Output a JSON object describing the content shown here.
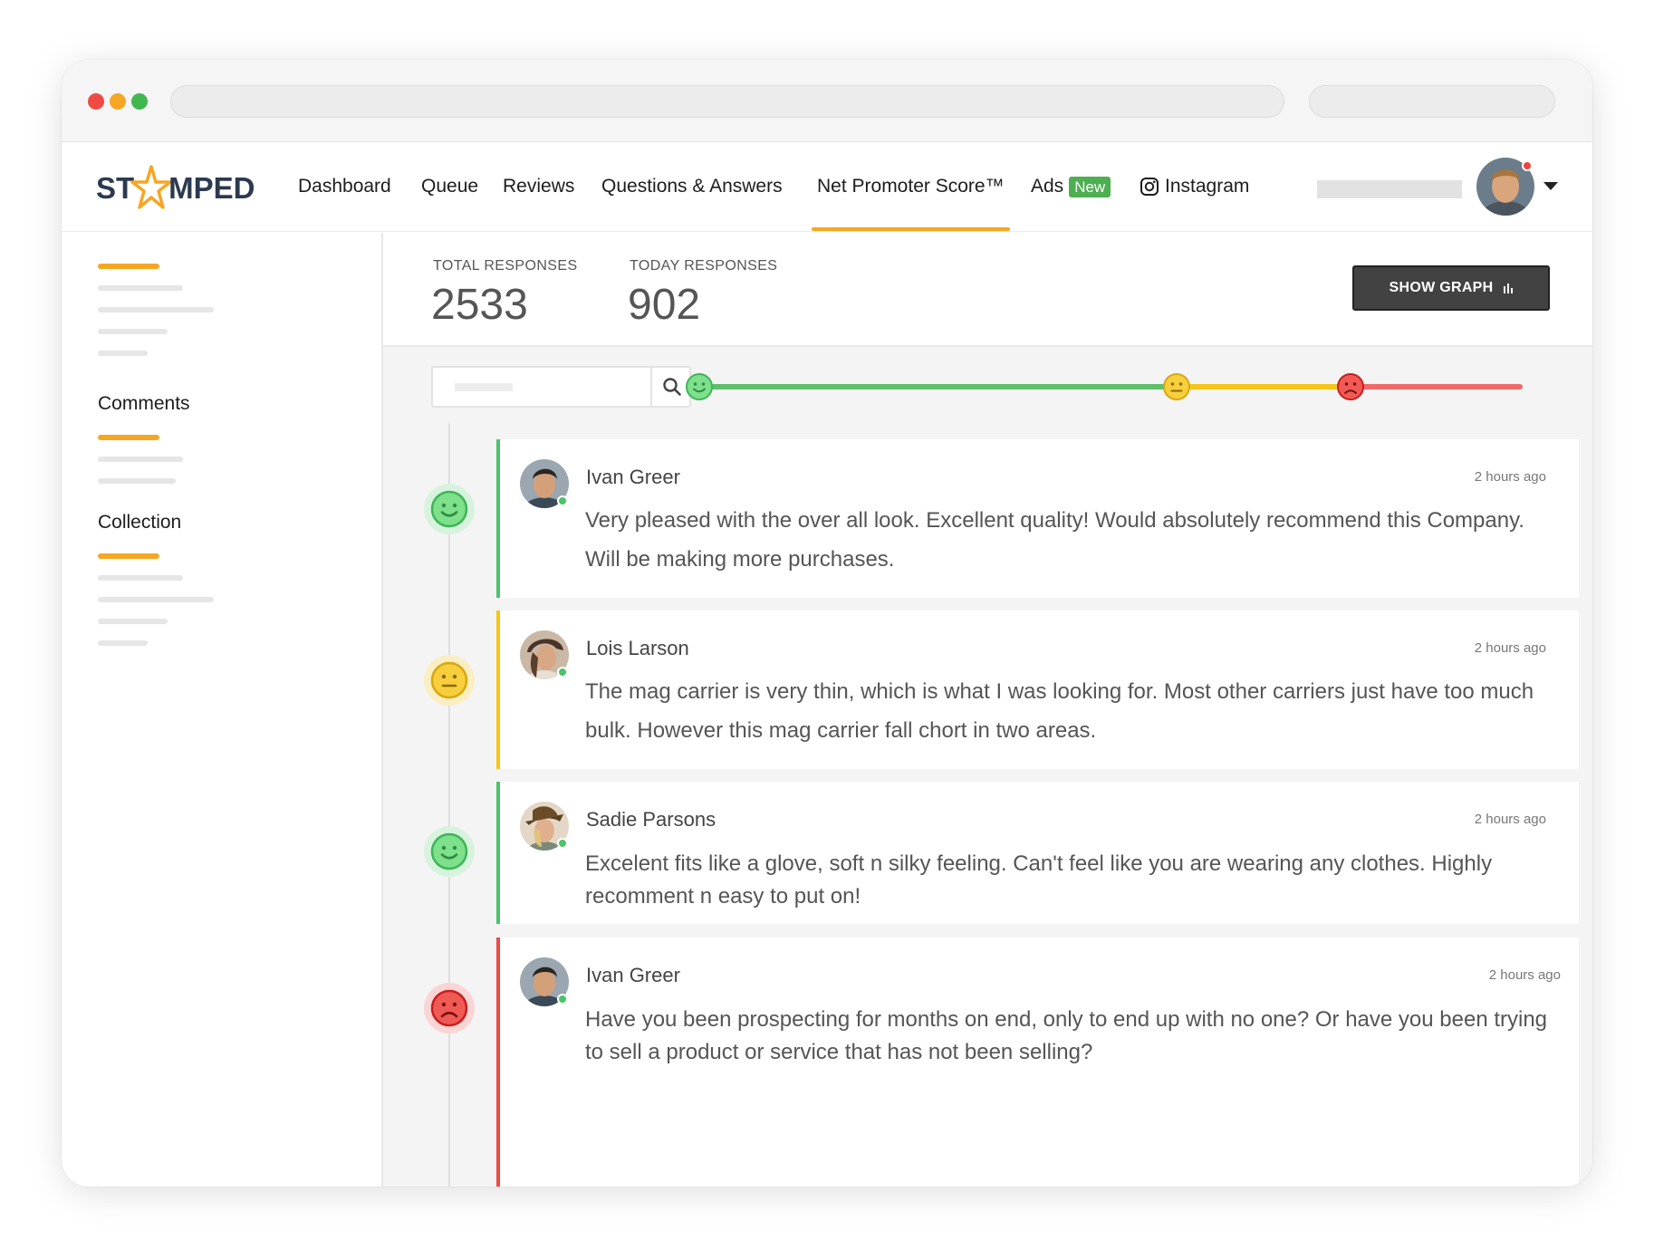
{
  "app": {
    "logo_left": "ST",
    "logo_right": "MPED"
  },
  "nav": {
    "items": [
      {
        "label": "Dashboard"
      },
      {
        "label": "Queue"
      },
      {
        "label": "Reviews"
      },
      {
        "label": "Questions & Answers"
      },
      {
        "label": "Net Promoter Score™",
        "active": true
      },
      {
        "label": "Ads",
        "badge": "New"
      },
      {
        "label": "Instagram"
      }
    ]
  },
  "sidebar": {
    "sections": [
      {
        "title": "Comments"
      },
      {
        "title": "Collection"
      }
    ]
  },
  "stats": {
    "total_label": "TOTAL RESPONSES",
    "total_value": "2533",
    "today_label": "TODAY RESPONSES",
    "today_value": "902"
  },
  "show_graph_label": "SHOW GRAPH",
  "search": {
    "placeholder": ""
  },
  "colors": {
    "accent": "#f5a724",
    "promoter": "#4cc36a",
    "passive": "#f5c518",
    "detractor": "#f04a45"
  },
  "reviews": [
    {
      "name": "Ivan Greer",
      "time": "2 hours ago",
      "text": "Very pleased with the over all look. Excellent quality! Would absolutely recommend this Company. Will be making more purchases.",
      "mood": "happy"
    },
    {
      "name": "Lois Larson",
      "time": "2 hours ago",
      "text": "The mag carrier is very thin, which is what I was looking for. Most other carriers just have too much bulk. However this mag carrier fall chort in two areas.",
      "mood": "neutral"
    },
    {
      "name": "Sadie Parsons",
      "time": "2 hours ago",
      "text": "Excelent fits like a glove, soft n silky feeling. Can't feel like you are wearing any clothes. Highly recomment n easy to put on!",
      "mood": "happy"
    },
    {
      "name": "Ivan Greer",
      "time": "2 hours ago",
      "text": "Have you been prospecting for months on end, only to end up with no one? Or have you been trying to sell a product or service that has not been selling?",
      "mood": "sad"
    }
  ]
}
